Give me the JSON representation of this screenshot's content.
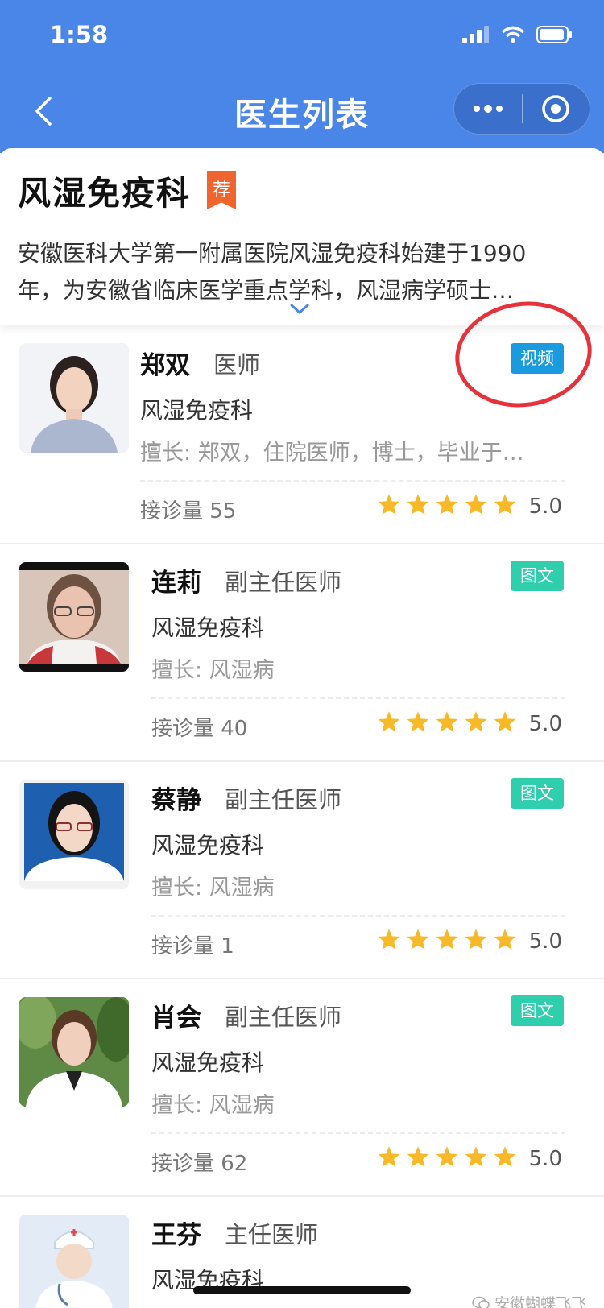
{
  "status_bar": {
    "time": "1:58"
  },
  "nav": {
    "title": "医生列表"
  },
  "department": {
    "name": "风湿免疫科",
    "badge": "荐",
    "description": "安徽医科大学第一附属医院风湿免疫科始建于1990\n年，为安徽省临床医学重点学科，风湿病学硕士…"
  },
  "doctors": [
    {
      "name": "郑双",
      "title": "医师",
      "dept": "风湿免疫科",
      "skill": "擅长: 郑双，住院医师，博士，毕业于…",
      "count": "接诊量 55",
      "rating": "5.0",
      "tag": "视频",
      "stars": 5
    },
    {
      "name": "连莉",
      "title": "副主任医师",
      "dept": "风湿免疫科",
      "skill": "擅长: 风湿病",
      "count": "接诊量 40",
      "rating": "5.0",
      "tag": "图文",
      "stars": 5
    },
    {
      "name": "蔡静",
      "title": "副主任医师",
      "dept": "风湿免疫科",
      "skill": "擅长: 风湿病",
      "count": "接诊量 1",
      "rating": "5.0",
      "tag": "图文",
      "stars": 5
    },
    {
      "name": "肖会",
      "title": "副主任医师",
      "dept": "风湿免疫科",
      "skill": "擅长: 风湿病",
      "count": "接诊量 62",
      "rating": "5.0",
      "tag": "图文",
      "stars": 5
    },
    {
      "name": "王芬",
      "title": "主任医师",
      "dept": "风湿免疫科"
    }
  ],
  "watermark": "安徽蝴蝶飞飞",
  "colors": {
    "header": "#4a86e8",
    "star": "#f7b928",
    "video_tag": "#1a9be0",
    "text_tag": "#2fcfae",
    "annotation": "#e8323b"
  }
}
